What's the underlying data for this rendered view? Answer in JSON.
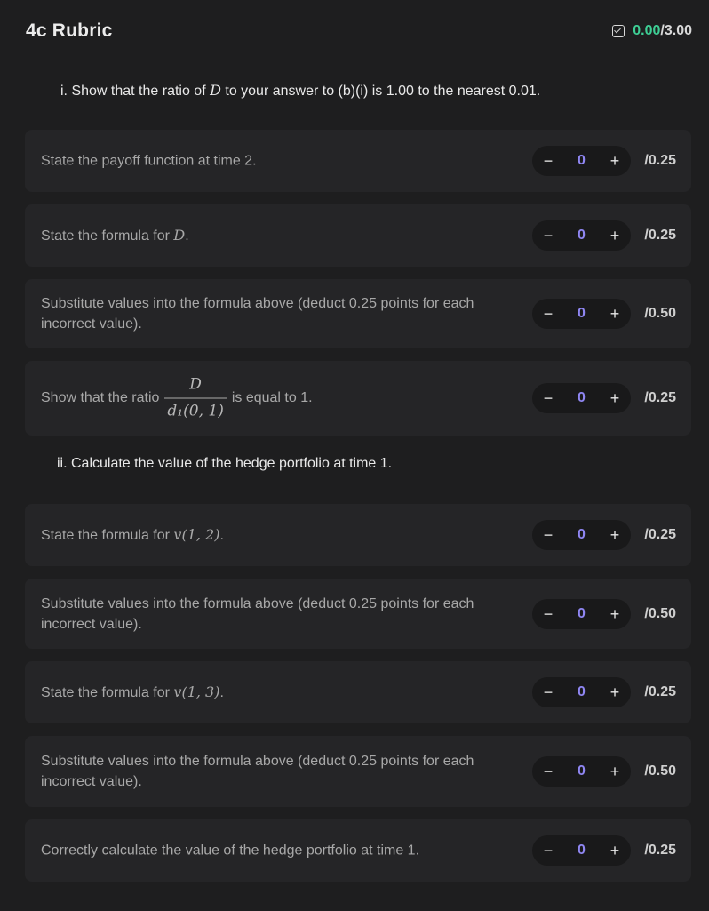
{
  "header": {
    "title": "4c Rubric",
    "score_earned": "0.00",
    "score_sep": "/",
    "score_total": "3.00"
  },
  "colors": {
    "accent_green": "#3ecf95",
    "accent_purple": "#8f86f2",
    "background": "#1e1e1f",
    "card": "#252527"
  },
  "sections": [
    {
      "heading_pre": "i. Show that the ratio of ",
      "heading_var": "D",
      "heading_post": " to your answer to (b)(i) is 1.00 to the nearest 0.01.",
      "items": [
        {
          "label": "State the payoff function at time 2.",
          "value": "0",
          "max": "/0.25"
        },
        {
          "label_pre": "State the formula for ",
          "label_var": "D",
          "label_post": ".",
          "value": "0",
          "max": "/0.25"
        },
        {
          "label": "Substitute values into the formula above (deduct 0.25 points for each incorrect value).",
          "value": "0",
          "max": "/0.50"
        },
        {
          "label_pre": "Show that the ratio",
          "frac_num": "D",
          "frac_den": "d₁(0, 1)",
          "label_post": "is equal to 1.",
          "value": "0",
          "max": "/0.25"
        }
      ]
    },
    {
      "heading": "ii. Calculate the value of the hedge portfolio at time 1.",
      "items": [
        {
          "label_pre": "State the formula for ",
          "label_var": "v(1, 2)",
          "label_post": ".",
          "value": "0",
          "max": "/0.25"
        },
        {
          "label": "Substitute values into the formula above (deduct 0.25 points for each incorrect value).",
          "value": "0",
          "max": "/0.50"
        },
        {
          "label_pre": "State the formula for ",
          "label_var": "v(1, 3)",
          "label_post": ".",
          "value": "0",
          "max": "/0.25"
        },
        {
          "label": "Substitute values into the formula above (deduct 0.25 points for each incorrect value).",
          "value": "0",
          "max": "/0.50"
        },
        {
          "label": "Correctly calculate the value of the hedge portfolio at time 1.",
          "value": "0",
          "max": "/0.25"
        }
      ]
    }
  ],
  "stepper": {
    "minus_symbol": "−",
    "plus_symbol": "+"
  }
}
